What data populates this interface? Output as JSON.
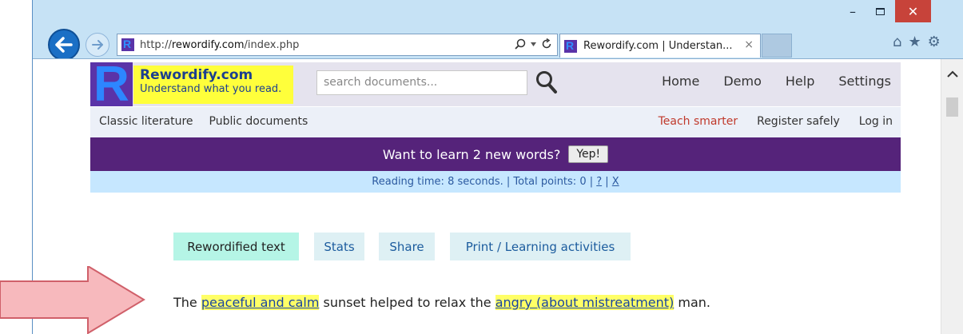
{
  "browser": {
    "url_prefix": "http://",
    "url_domain": "rewordify.com",
    "url_path": "/index.php",
    "tab_title": "Rewordify.com | Understan...",
    "tab_close": "×",
    "win_min": "–",
    "win_close": "✕",
    "tb_home": "⌂",
    "tb_star": "★",
    "tb_gear": "⚙",
    "icons": [
      "back-arrow-icon",
      "forward-arrow-icon",
      "search-icon",
      "refresh-icon",
      "home-icon",
      "star-icon",
      "gear-icon"
    ]
  },
  "site": {
    "logo_letter": "R",
    "name": "Rewordify.com",
    "tagline": "Understand what you read.",
    "search_placeholder": "search documents...",
    "top_nav": [
      "Home",
      "Demo",
      "Help",
      "Settings"
    ],
    "sub_nav_left": [
      "Classic literature",
      "Public documents"
    ],
    "sub_nav_right": [
      "Teach smarter",
      "Register safely",
      "Log in"
    ]
  },
  "promo": {
    "text": "Want to learn 2 new words?",
    "button": "Yep!"
  },
  "info_bar": {
    "reading_time": "Reading time: 8 seconds. | Total points: 0 | ",
    "help_link": "?",
    "sep": " | ",
    "close_link": "X"
  },
  "content_tabs": [
    "Rewordified text",
    "Stats",
    "Share",
    "Print / Learning activities"
  ],
  "sentence": {
    "part1": "The ",
    "hl1": "peaceful and calm",
    "part2": " sunset helped to relax the ",
    "hl2": "angry (about mistreatment)",
    "part3": " man."
  },
  "colors": {
    "brand_purple": "#55237a",
    "logo_blue": "#2d86ff",
    "logo_yellow": "#ffff3b",
    "highlight": "#ffff66",
    "arrow_fill": "#f7b9bd",
    "arrow_stroke": "#d0606a"
  }
}
